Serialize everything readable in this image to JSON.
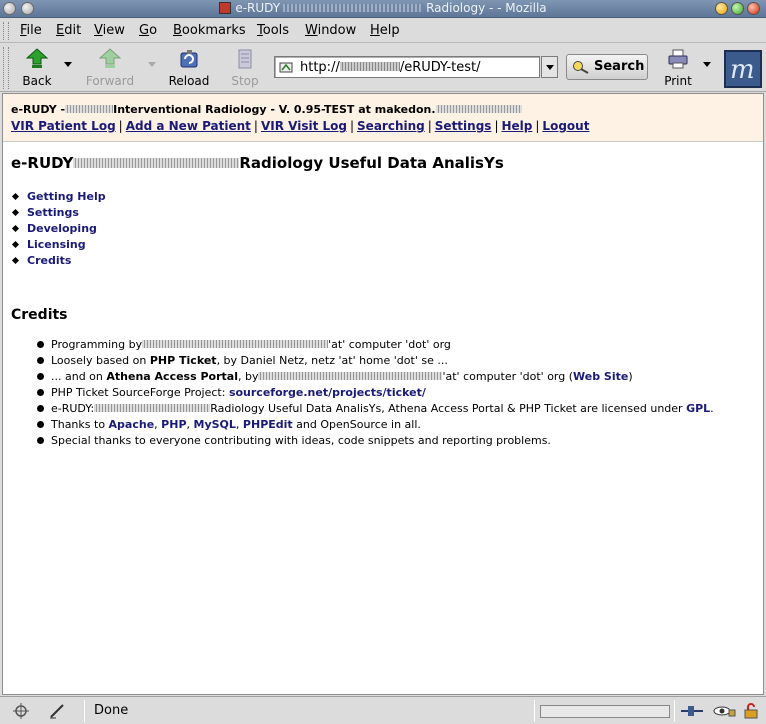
{
  "window": {
    "title_prefix": "e-RUDY",
    "title_suffix": "Radiology - - Mozilla"
  },
  "menu": [
    "File",
    "Edit",
    "View",
    "Go",
    "Bookmarks",
    "Tools",
    "Window",
    "Help"
  ],
  "toolbar": {
    "back": "Back",
    "forward": "Forward",
    "reload": "Reload",
    "stop": "Stop",
    "url_prefix": "http://",
    "url_suffix": "/eRUDY-test/",
    "search": "Search",
    "print": "Print"
  },
  "header": {
    "title_prefix": "e-RUDY -",
    "title_middle": "Interventional Radiology - V. 0.95-TEST at makedon.",
    "nav": [
      "VIR Patient Log",
      "Add a New Patient",
      "VIR Visit Log",
      "Searching",
      "Settings",
      "Help",
      "Logout"
    ]
  },
  "page": {
    "title_prefix": "e-RUDY",
    "title_suffix": "Radiology Useful Data AnalisYs",
    "toc": [
      "Getting Help",
      "Settings",
      "Developing",
      "Licensing",
      "Credits"
    ],
    "section_title": "Credits",
    "credits": {
      "c1_a": "Programming by",
      "c1_b": "'at' computer 'dot' org",
      "c2_a": "Loosely based on",
      "c2_b": "PHP Ticket",
      "c2_c": ", by Daniel Netz, netz 'at' home 'dot' se ...",
      "c3_a": "... and on",
      "c3_b": "Athena Access Portal",
      "c3_c": ", by",
      "c3_d": "'at' computer 'dot' org (",
      "c3_e": "Web Site",
      "c3_f": ")",
      "c4_a": "PHP Ticket SourceForge Project:",
      "c4_b": "sourceforge.net/projects/ticket/",
      "c5_a": "e-RUDY:",
      "c5_b": "Radiology Useful Data AnalisYs, Athena Access Portal & PHP Ticket are licensed under",
      "c5_c": "GPL",
      "c5_d": ".",
      "c6_a": "Thanks to",
      "c6_b": "Apache",
      "c6_c": "PHP",
      "c6_d": "MySQL",
      "c6_e": "PHPEdit",
      "c6_f": "and OpenSource in all.",
      "c7": "Special thanks to everyone contributing with ideas, code snippets and reporting problems."
    }
  },
  "status": {
    "text": "Done"
  },
  "colors": {
    "link": "#1a1a78",
    "header_band": "#fdf2e4"
  }
}
